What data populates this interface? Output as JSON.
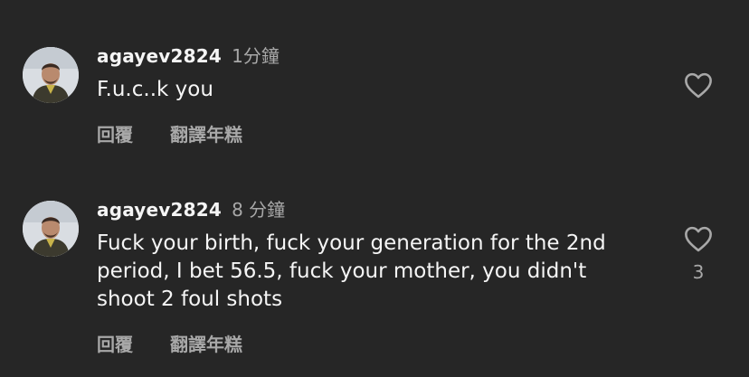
{
  "comments": [
    {
      "username": "agayev2824",
      "time": "1分鐘",
      "text": "F.u.c..k you",
      "reply_label": "回覆",
      "translate_label": "翻譯年糕",
      "like_icon": "heart-outline-icon",
      "like_count": ""
    },
    {
      "username": "agayev2824",
      "time": "8 分鐘",
      "text": "Fuck your birth, fuck your generation for the 2nd period, I bet 56.5, fuck your mother, you didn't shoot 2 foul shots",
      "reply_label": "回覆",
      "translate_label": "翻譯年糕",
      "like_icon": "heart-outline-icon",
      "like_count": "3"
    }
  ]
}
